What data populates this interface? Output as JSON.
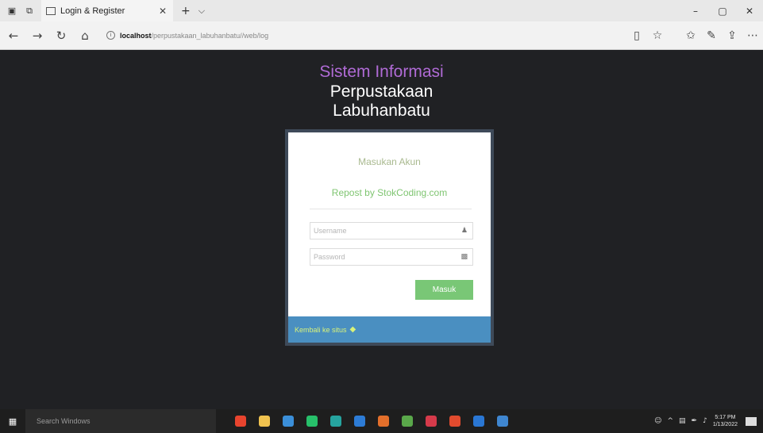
{
  "browser": {
    "tab_title": "Login & Register",
    "url_host": "localhost",
    "url_path": "/perpustakaan_labuhanbatu//web/log"
  },
  "page": {
    "title_line1": "Sistem Informasi",
    "title_line2": "Perpustakaan",
    "title_line3": "Labuhanbatu",
    "heading": "Masukan Akun",
    "subheading": "Repost by StokCoding.com",
    "username_placeholder": "Username",
    "password_placeholder": "Password",
    "submit_label": "Masuk",
    "back_link": "Kembali ke situs"
  },
  "taskbar": {
    "search_placeholder": "Search Windows",
    "time": "5:17 PM",
    "date": "1/13/2022"
  },
  "colors": {
    "page_bg": "#202124",
    "title_accent": "#b06bd6",
    "button": "#79c776",
    "footer": "#4a8fc1"
  }
}
